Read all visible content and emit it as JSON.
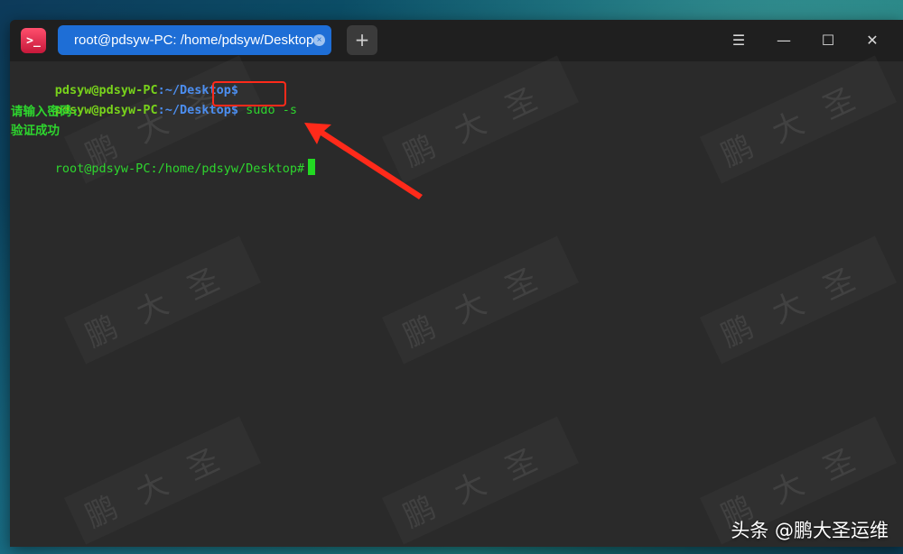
{
  "window": {
    "tab_title": "root@pdsyw-PC: /home/pdsyw/Desktop",
    "tab_close_glyph": "×",
    "new_tab_glyph": "+",
    "controls": {
      "menu": "☰",
      "minimize": "—",
      "maximize": "☐",
      "close": "✕"
    }
  },
  "terminal": {
    "lines": [
      {
        "user_host": "pdsyw@pdsyw-PC",
        "sep": ":",
        "path": "~/Desktop",
        "prompt": "$",
        "command": ""
      },
      {
        "user_host": "pdsyw@pdsyw-PC",
        "sep": ":",
        "path": "~/Desktop",
        "prompt": "$",
        "command": " sudo -s"
      },
      {
        "text": "请输入密码:"
      },
      {
        "text": "验证成功"
      },
      {
        "text": "root@pdsyw-PC:/home/pdsyw/Desktop#"
      }
    ]
  },
  "watermark_text": "鹏大圣",
  "credit": "头条 @鹏大圣运维",
  "colors": {
    "tab_active": "#1e6ed6",
    "terminal_bg": "#2a2a2a",
    "prompt_user": "#78d21b",
    "prompt_path": "#4c8ef0",
    "output_text": "#2ed52e",
    "annotation": "#ff2a1a",
    "app_icon": "#e6254a"
  },
  "icons": {
    "app": "terminal-icon",
    "tab_close": "close-icon",
    "new_tab": "plus-icon",
    "menu": "hamburger-menu-icon",
    "minimize": "minimize-icon",
    "maximize": "maximize-icon",
    "close": "close-window-icon"
  }
}
